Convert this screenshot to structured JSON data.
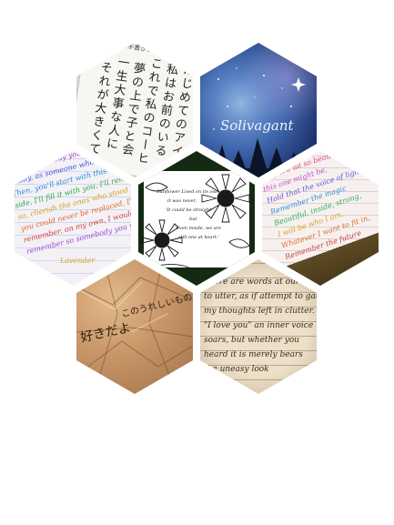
{
  "collage": {
    "tiles": [
      {
        "id": "japanese-calligraphy",
        "tilt_deg": 8,
        "texts": {
          "columns": [
            "はじめてのアイ",
            "私はお前のいる",
            "これで私のコーヒ",
            "夢の上で子と会",
            "一生大事な人に",
            "それが大きくて"
          ],
          "header": "はじめての手書きTeacher"
        }
      },
      {
        "id": "solivagant-night-sky",
        "title": "Solivagant",
        "colors": {
          "sky_top": "#1c2d6b",
          "sky_mid": "#3d64a8",
          "sky_light": "#8fb5e0",
          "trees": "#0c1428"
        }
      },
      {
        "id": "rainbow-cursive-left",
        "lines": [
          "arganic, one day you'll look back",
          "finally, as someone who didn't fail,",
          "Then, you'll start with this book",
          "side, I'll fill it with you, I'll remember",
          "so, cherish the ones who stood beside you,",
          "you could never be replaced, I'm here",
          "remember, on my own, I would carry the",
          "remember so somebody you would"
        ],
        "footer": "Lavender",
        "colors": [
          "#b03ec8",
          "#3a56d4",
          "#1f8ad6",
          "#2aa84a",
          "#d1a41d",
          "#e06a20",
          "#d43a3a",
          "#9a4bd0"
        ]
      },
      {
        "id": "sunflower-sketch",
        "quote_lines": [
          "Sunflower Lived on its own,",
          "it was never,",
          "'It could be straight'",
          "but",
          "'Even inside, we are",
          "still one at heart.'"
        ],
        "colors": {
          "ink": "#1a1a1a",
          "paper": "#ffffff",
          "leaf": "#1d6b2a"
        }
      },
      {
        "id": "rainbow-cursive-right",
        "lines": [
          "They are all so beautiful,",
          "this one might be,",
          "Hold that the voice of light,",
          "Remember the magic",
          "Beautiful, inside, strong,",
          "I will be who I am,",
          "Whatever I want to fit in,",
          "Remember the future"
        ],
        "colors": [
          "#e4437a",
          "#c74fd0",
          "#6a58d8",
          "#2f8fd8",
          "#2fae63",
          "#d9a52a",
          "#e06d2a",
          "#cc3f3f"
        ]
      },
      {
        "id": "crumpled-paper",
        "lines": [
          "好きだよ",
          "このうれしいもの"
        ],
        "colors": {
          "paper": "#c79668",
          "ink": "#2b1d12"
        }
      },
      {
        "id": "lined-cursive",
        "lines": [
          "there are words at our unable",
          "to utter, as if attempt to gather",
          "my thoughts left in clutter.",
          "\"I love you\" an inner voice",
          "soars, but whether you",
          "heard it is merely bears",
          "the uneasy look"
        ],
        "colors": {
          "paper": "#ece0c8",
          "ink": "#3a2c22",
          "rule": "#b9a88d"
        }
      }
    ]
  }
}
